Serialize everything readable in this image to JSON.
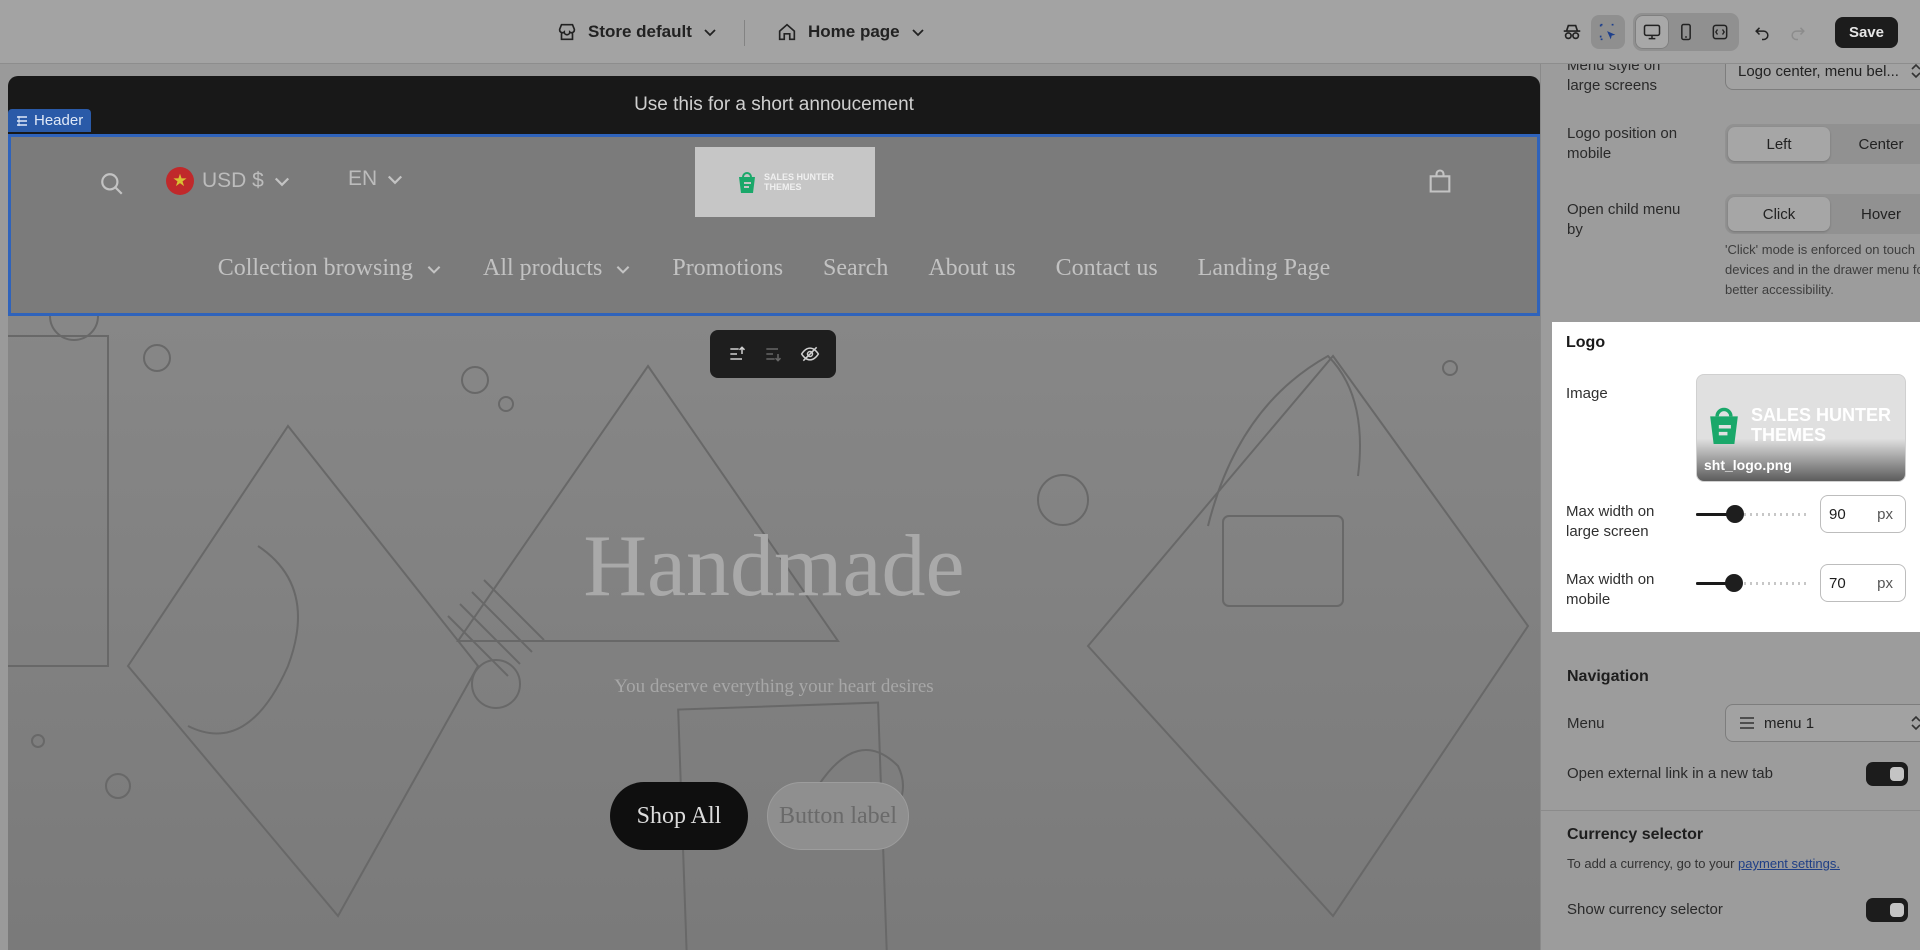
{
  "topbar": {
    "theme_label": "Store default",
    "page_label": "Home page",
    "save_label": "Save"
  },
  "preview": {
    "announcement": "Use this for a short annoucement",
    "header_tag": "Header",
    "currency": "USD $",
    "language": "EN",
    "logo_text_line1": "SALES HUNTER",
    "logo_text_line2": "THEMES",
    "nav": [
      {
        "label": "Collection browsing",
        "dropdown": true
      },
      {
        "label": "All products",
        "dropdown": true
      },
      {
        "label": "Promotions",
        "dropdown": false
      },
      {
        "label": "Search",
        "dropdown": false
      },
      {
        "label": "About us",
        "dropdown": false
      },
      {
        "label": "Contact us",
        "dropdown": false
      },
      {
        "label": "Landing Page",
        "dropdown": false
      }
    ],
    "hero_title": "Handmade",
    "hero_subtitle": "You deserve everything your heart desires",
    "primary_button": "Shop All",
    "secondary_button": "Button label"
  },
  "panel": {
    "menu_style_label": "Menu style on large screens",
    "menu_style_value": "Logo center, menu bel...",
    "logo_position_label": "Logo position on mobile",
    "logo_position_options": [
      "Left",
      "Center"
    ],
    "logo_position_selected": "Left",
    "child_menu_label": "Open child menu by",
    "child_menu_options": [
      "Click",
      "Hover"
    ],
    "child_menu_selected": "Click",
    "child_menu_hint": "'Click' mode is enforced on touch devices and in the drawer menu for better accessibility.",
    "logo": {
      "title": "Logo",
      "image_label": "Image",
      "image_text_line1": "SALES HUNTER",
      "image_text_line2": "THEMES",
      "image_filename": "sht_logo.png",
      "max_width_large_label": "Max width on large screen",
      "max_width_large_value": "90",
      "max_width_large_fraction": 0.35,
      "max_width_mobile_label": "Max width on mobile",
      "max_width_mobile_value": "70",
      "max_width_mobile_fraction": 0.34,
      "unit": "px"
    },
    "navigation": {
      "title": "Navigation",
      "menu_label": "Menu",
      "menu_value": "menu 1",
      "external_link_label": "Open external link in a new tab",
      "external_link_on": true
    },
    "currency": {
      "title": "Currency selector",
      "hint_prefix": "To add a currency, go to your",
      "hint_link": "payment settings.",
      "show_label": "Show currency selector",
      "show_on": true
    }
  },
  "colors": {
    "accent_blue": "#2f63bb",
    "logo_green": "#1aa86a",
    "save_bg": "#1c1c1c"
  }
}
